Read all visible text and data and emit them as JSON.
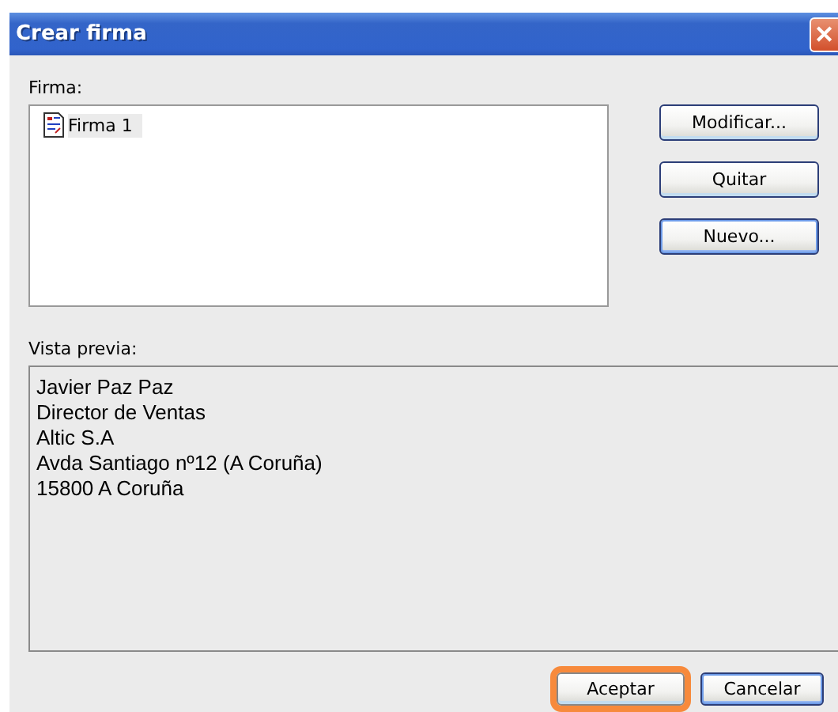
{
  "window": {
    "title": "Crear firma",
    "close_icon": "✕"
  },
  "signature_list": {
    "label": "Firma:",
    "items": [
      {
        "label": "Firma 1",
        "selected": true
      }
    ]
  },
  "side_buttons": [
    {
      "label": "Modificar...",
      "default": false
    },
    {
      "label": "Quitar",
      "default": false
    },
    {
      "label": "Nuevo...",
      "default": true
    }
  ],
  "preview": {
    "label": "Vista previa:",
    "lines": [
      "Javier Paz Paz",
      "Director de Ventas",
      "Altic S.A",
      "Avda Santiago nº12 (A Coruña)",
      "15800 A Coruña"
    ]
  },
  "footer_buttons": [
    {
      "label": "Aceptar",
      "highlighted": true,
      "default": false
    },
    {
      "label": "Cancelar",
      "highlighted": false,
      "default": true
    }
  ]
}
